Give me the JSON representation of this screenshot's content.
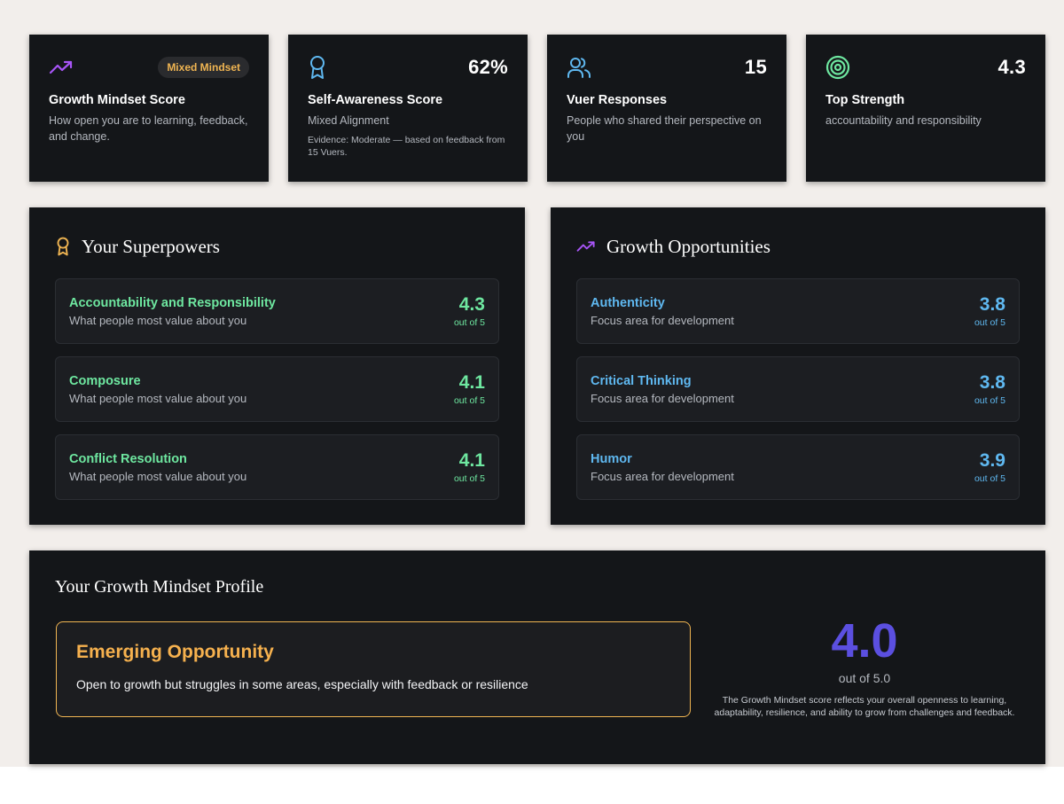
{
  "stats": {
    "growth": {
      "badge": "Mixed Mindset",
      "title": "Growth Mindset Score",
      "sub": "How open you are to learning, feedback, and change.",
      "icon": "trending-up-icon"
    },
    "awareness": {
      "value": "62%",
      "title": "Self-Awareness Score",
      "sub": "Mixed Alignment",
      "evidence": "Evidence: Moderate — based on feedback from 15 Vuers.",
      "icon": "award-icon"
    },
    "responses": {
      "value": "15",
      "title": "Vuer Responses",
      "sub": "People who shared their perspective on you",
      "icon": "users-icon"
    },
    "strength": {
      "value": "4.3",
      "title": "Top Strength",
      "sub": "accountability and responsibility",
      "icon": "target-icon"
    }
  },
  "superpowers": {
    "title": "Your Superpowers",
    "icon": "award-icon",
    "items": [
      {
        "name": "Accountability and Responsibility",
        "desc": "What people most value about you",
        "score": "4.3",
        "out": "out of 5"
      },
      {
        "name": "Composure",
        "desc": "What people most value about you",
        "score": "4.1",
        "out": "out of 5"
      },
      {
        "name": "Conflict Resolution",
        "desc": "What people most value about you",
        "score": "4.1",
        "out": "out of 5"
      }
    ]
  },
  "opportunities": {
    "title": "Growth Opportunities",
    "icon": "trending-up-icon",
    "items": [
      {
        "name": "Authenticity",
        "desc": "Focus area for development",
        "score": "3.8",
        "out": "out of 5"
      },
      {
        "name": "Critical Thinking",
        "desc": "Focus area for development",
        "score": "3.8",
        "out": "out of 5"
      },
      {
        "name": "Humor",
        "desc": "Focus area for development",
        "score": "3.9",
        "out": "out of 5"
      }
    ]
  },
  "profile": {
    "title": "Your Growth Mindset Profile",
    "level_name": "Emerging Opportunity",
    "level_desc": "Open to growth but struggles in some areas, especially with feedback or resilience",
    "score": "4.0",
    "score_out": "out of 5.0",
    "score_desc": "The Growth Mindset score reflects your overall openness to learning, adaptability, resilience, and ability to grow from challenges and feedback."
  },
  "colors": {
    "card_bg": "#141619",
    "accent_purple": "#5b4fe0",
    "green": "#6ee7a0",
    "blue": "#5fb8f0",
    "amber": "#f0b552"
  }
}
